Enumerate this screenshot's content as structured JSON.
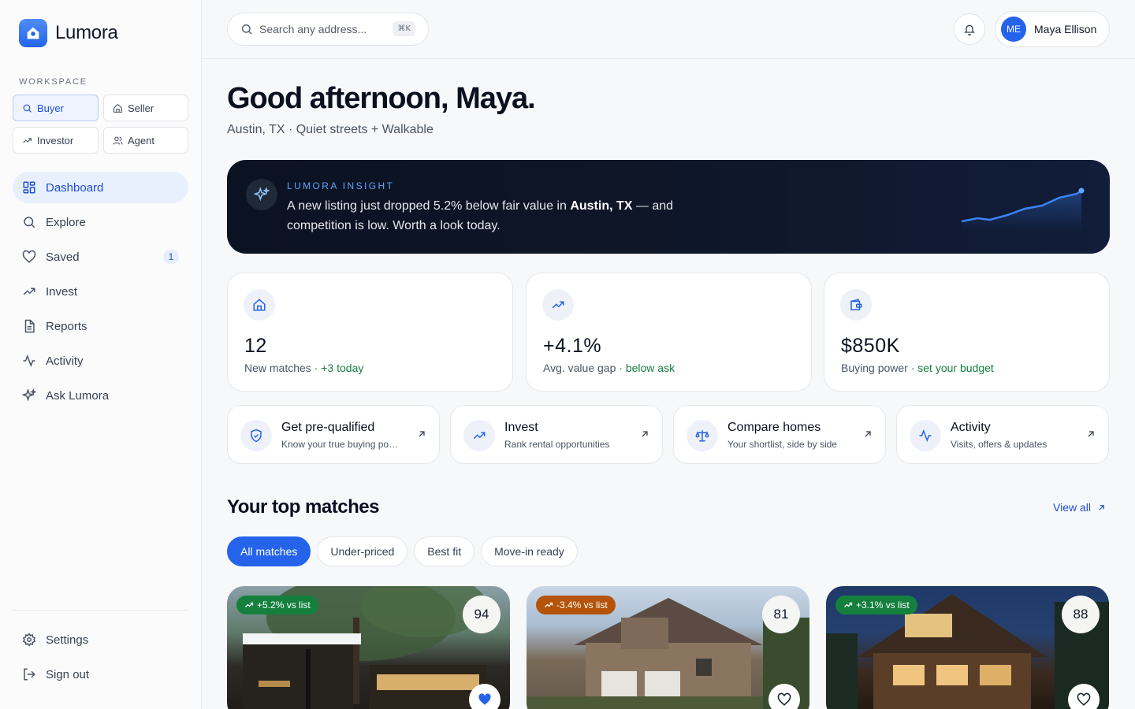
{
  "brand": {
    "name": "Lumora"
  },
  "workspace": {
    "label": "WORKSPACE",
    "roles": [
      {
        "label": "Buyer",
        "icon": "search-icon",
        "active": true
      },
      {
        "label": "Seller",
        "icon": "home-icon",
        "active": false
      },
      {
        "label": "Investor",
        "icon": "trend-up-icon",
        "active": false
      },
      {
        "label": "Agent",
        "icon": "users-icon",
        "active": false
      }
    ]
  },
  "nav": {
    "items": [
      {
        "label": "Dashboard",
        "icon": "grid-icon",
        "active": true
      },
      {
        "label": "Explore",
        "icon": "search-icon"
      },
      {
        "label": "Saved",
        "icon": "heart-icon",
        "badge": "1"
      },
      {
        "label": "Invest",
        "icon": "trend-up-icon"
      },
      {
        "label": "Reports",
        "icon": "document-icon"
      },
      {
        "label": "Activity",
        "icon": "pulse-icon"
      },
      {
        "label": "Ask Lumora",
        "icon": "sparkle-icon"
      }
    ],
    "bottom": [
      {
        "label": "Settings",
        "icon": "gear-icon"
      },
      {
        "label": "Sign out",
        "icon": "sign-out-icon"
      }
    ]
  },
  "header": {
    "search_placeholder": "Search any address...",
    "shortcut": "⌘K",
    "user": {
      "initials": "ME",
      "name": "Maya Ellison"
    }
  },
  "greeting": {
    "title": "Good afternoon, Maya.",
    "subtitle": "Austin, TX · Quiet streets + Walkable"
  },
  "insight": {
    "label": "LUMORA INSIGHT",
    "text_before": "A new listing just dropped 5.2% below fair value in ",
    "text_bold": "Austin, TX",
    "text_after": " — and competition is low. Worth a look today."
  },
  "stats": [
    {
      "value": "12",
      "label": "New matches",
      "highlight": "· +3 today",
      "icon": "home-icon"
    },
    {
      "value": "+4.1%",
      "label": "Avg. value gap",
      "highlight": "· below ask",
      "icon": "trend-up-icon"
    },
    {
      "value": "$850K",
      "label": "Buying power",
      "highlight": "· set your budget",
      "icon": "wallet-icon"
    }
  ],
  "actions": [
    {
      "title": "Get pre-qualified",
      "subtitle": "Know your true buying power",
      "icon": "shield-check-icon"
    },
    {
      "title": "Invest",
      "subtitle": "Rank rental opportunities",
      "icon": "trend-up-icon"
    },
    {
      "title": "Compare homes",
      "subtitle": "Your shortlist, side by side",
      "icon": "scale-icon"
    },
    {
      "title": "Activity",
      "subtitle": "Visits, offers & updates",
      "icon": "pulse-icon"
    }
  ],
  "matches": {
    "title": "Your top matches",
    "view_all": "View all",
    "filters": [
      {
        "label": "All matches",
        "active": true
      },
      {
        "label": "Under-priced"
      },
      {
        "label": "Best fit"
      },
      {
        "label": "Move-in ready"
      }
    ],
    "cards": [
      {
        "delta": "+5.2% vs list",
        "delta_color": "#15803d",
        "score": "94",
        "saved": true
      },
      {
        "delta": "-3.4% vs list",
        "delta_color": "#b45309",
        "score": "81",
        "saved": false
      },
      {
        "delta": "+3.1% vs list",
        "delta_color": "#15803d",
        "score": "88",
        "saved": false
      }
    ]
  },
  "colors": {
    "accent": "#2563eb",
    "positive": "#15803d",
    "warning": "#b45309",
    "dark_banner": "#0f172a"
  }
}
